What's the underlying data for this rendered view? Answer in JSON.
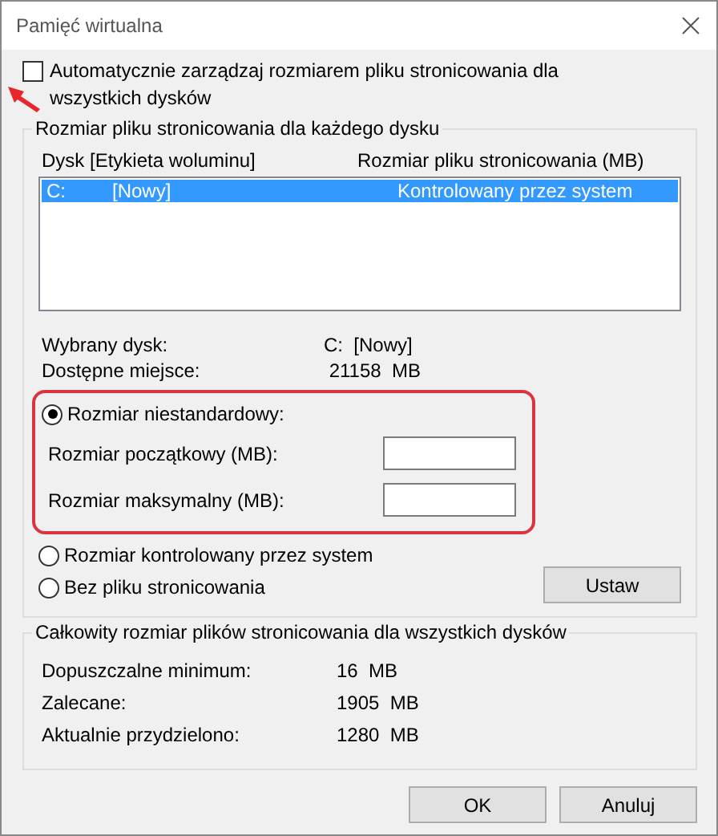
{
  "window": {
    "title": "Pamięć wirtualna"
  },
  "auto_manage": {
    "label": "Automatycznie zarządzaj rozmiarem pliku stronicowania dla wszystkich dysków",
    "checked": false
  },
  "per_disk": {
    "title": "Rozmiar pliku stronicowania dla każdego dysku",
    "columns": [
      "Dysk [Etykieta woluminu]",
      "Rozmiar pliku stronicowania (MB)"
    ],
    "rows": [
      {
        "drive": "C:",
        "label": "[Nowy]",
        "size": "Kontrolowany przez system",
        "selected": true
      }
    ],
    "info": [
      {
        "label": "Wybrany dysk:",
        "value": "C:  [Nowy]"
      },
      {
        "label": "Dostępne miejsce:",
        "value": " 21158  MB"
      }
    ],
    "options": [
      {
        "label": "Rozmiar niestandardowy:",
        "selected": true
      },
      {
        "label": "Rozmiar kontrolowany przez system",
        "selected": false
      },
      {
        "label": "Bez pliku stronicowania",
        "selected": false
      }
    ],
    "fields": [
      {
        "label": "Rozmiar początkowy (MB):"
      },
      {
        "label": "Rozmiar maksymalny (MB):"
      }
    ],
    "set_button": "Ustaw"
  },
  "totals": {
    "title": "Całkowity rozmiar plików stronicowania dla wszystkich dysków",
    "rows": [
      {
        "label": "Dopuszczalne minimum:",
        "value": "16  MB"
      },
      {
        "label": "Zalecane:",
        "value": "1905  MB"
      },
      {
        "label": "Aktualnie przydzielono:",
        "value": "1280  MB"
      }
    ]
  },
  "buttons": [
    "OK",
    "Anuluj"
  ]
}
